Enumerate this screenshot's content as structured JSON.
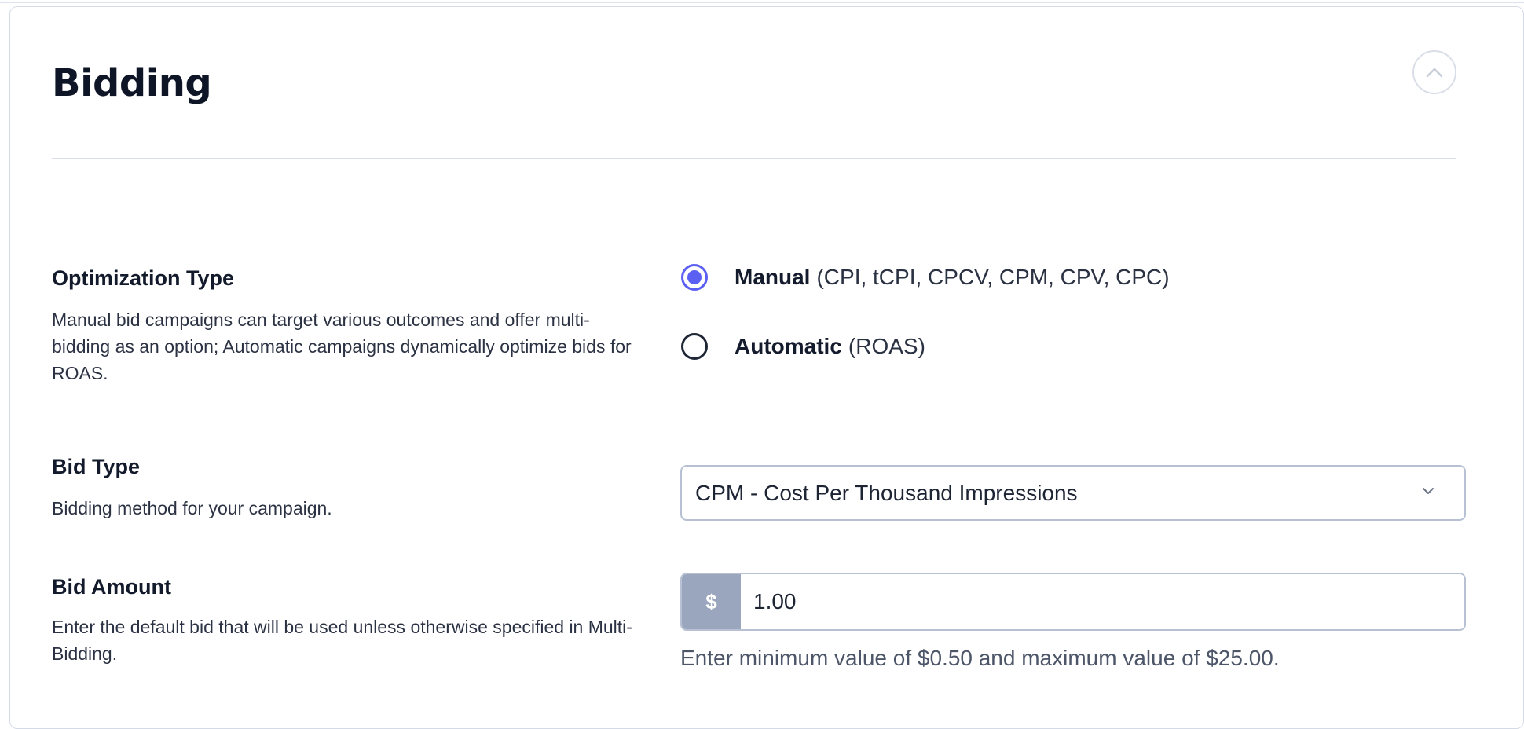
{
  "section": {
    "title": "Bidding",
    "collapse_icon": "chevron-up-icon"
  },
  "optimization": {
    "label": "Optimization Type",
    "description": "Manual bid campaigns can target various outcomes and offer multi-bidding as an option; Automatic campaigns dynamically optimize bids for ROAS.",
    "options": [
      {
        "name": "Manual",
        "detail": "(CPI, tCPI, CPCV, CPM, CPV, CPC)",
        "checked": true
      },
      {
        "name": "Automatic",
        "detail": "(ROAS)",
        "checked": false
      }
    ],
    "accent_color": "#5b5ff2"
  },
  "bid_type": {
    "label": "Bid Type",
    "description": "Bidding method for your campaign.",
    "selected": "CPM - Cost Per Thousand Impressions",
    "icon": "chevron-down-icon"
  },
  "bid_amount": {
    "label": "Bid Amount",
    "description": "Enter the default bid that will be used unless otherwise specified in Multi-Bidding.",
    "prefix": "$",
    "value": "1.00",
    "hint": "Enter minimum value of $0.50 and maximum value of $25.00."
  }
}
